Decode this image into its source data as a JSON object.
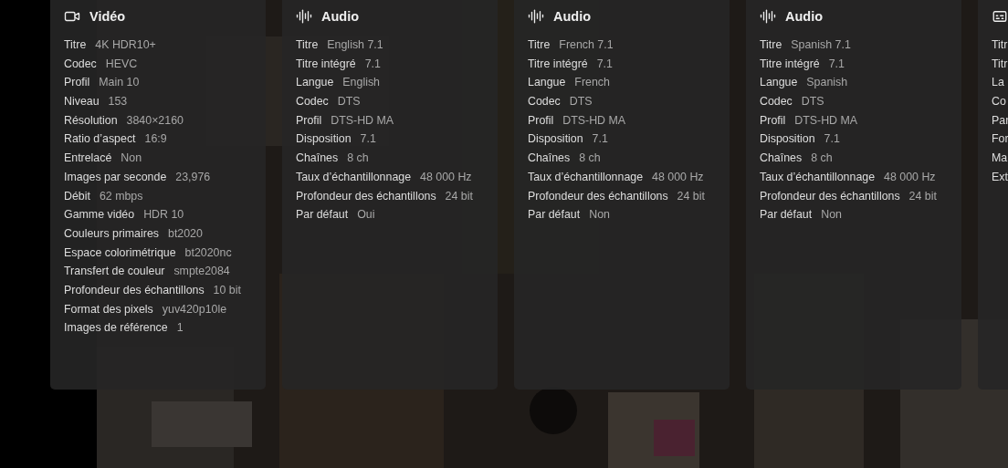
{
  "streams": [
    {
      "kind": "video",
      "title": "Vidéo",
      "rows": [
        {
          "label": "Titre",
          "value": "4K HDR10+"
        },
        {
          "label": "Codec",
          "value": "HEVC"
        },
        {
          "label": "Profil",
          "value": "Main 10"
        },
        {
          "label": "Niveau",
          "value": "153"
        },
        {
          "label": "Résolution",
          "value": "3840×2160"
        },
        {
          "label": "Ratio d’aspect",
          "value": "16:9"
        },
        {
          "label": "Entrelacé",
          "value": "Non"
        },
        {
          "label": "Images par seconde",
          "value": "23,976"
        },
        {
          "label": "Débit",
          "value": "62 mbps"
        },
        {
          "label": "Gamme vidéo",
          "value": "HDR 10"
        },
        {
          "label": "Couleurs primaires",
          "value": "bt2020"
        },
        {
          "label": "Espace colorimétrique",
          "value": "bt2020nc"
        },
        {
          "label": "Transfert de couleur",
          "value": "smpte2084"
        },
        {
          "label": "Profondeur des échantillons",
          "value": "10 bit"
        },
        {
          "label": "Format des pixels",
          "value": "yuv420p10le"
        },
        {
          "label": "Images de référence",
          "value": "1"
        }
      ]
    },
    {
      "kind": "audio",
      "title": "Audio",
      "rows": [
        {
          "label": "Titre",
          "value": "English 7.1"
        },
        {
          "label": "Titre intégré",
          "value": "7.1"
        },
        {
          "label": "Langue",
          "value": "English"
        },
        {
          "label": "Codec",
          "value": "DTS"
        },
        {
          "label": "Profil",
          "value": "DTS-HD MA"
        },
        {
          "label": "Disposition",
          "value": "7.1"
        },
        {
          "label": "Chaînes",
          "value": "8 ch"
        },
        {
          "label": "Taux d’échantillonnage",
          "value": "48 000 Hz"
        },
        {
          "label": "Profondeur des échantillons",
          "value": "24 bit"
        },
        {
          "label": "Par défaut",
          "value": "Oui"
        }
      ]
    },
    {
      "kind": "audio",
      "title": "Audio",
      "rows": [
        {
          "label": "Titre",
          "value": "French 7.1"
        },
        {
          "label": "Titre intégré",
          "value": "7.1"
        },
        {
          "label": "Langue",
          "value": "French"
        },
        {
          "label": "Codec",
          "value": "DTS"
        },
        {
          "label": "Profil",
          "value": "DTS-HD MA"
        },
        {
          "label": "Disposition",
          "value": "7.1"
        },
        {
          "label": "Chaînes",
          "value": "8 ch"
        },
        {
          "label": "Taux d’échantillonnage",
          "value": "48 000 Hz"
        },
        {
          "label": "Profondeur des échantillons",
          "value": "24 bit"
        },
        {
          "label": "Par défaut",
          "value": "Non"
        }
      ]
    },
    {
      "kind": "audio",
      "title": "Audio",
      "rows": [
        {
          "label": "Titre",
          "value": "Spanish 7.1"
        },
        {
          "label": "Titre intégré",
          "value": "7.1"
        },
        {
          "label": "Langue",
          "value": "Spanish"
        },
        {
          "label": "Codec",
          "value": "DTS"
        },
        {
          "label": "Profil",
          "value": "DTS-HD MA"
        },
        {
          "label": "Disposition",
          "value": "7.1"
        },
        {
          "label": "Chaînes",
          "value": "8 ch"
        },
        {
          "label": "Taux d’échantillonnage",
          "value": "48 000 Hz"
        },
        {
          "label": "Profondeur des échantillons",
          "value": "24 bit"
        },
        {
          "label": "Par défaut",
          "value": "Non"
        }
      ]
    },
    {
      "kind": "subtitle",
      "rows": [
        {
          "label": "Titr"
        },
        {
          "label": "Titr"
        },
        {
          "label": "La"
        },
        {
          "label": "Co"
        },
        {
          "label": "Par"
        },
        {
          "label": "For"
        },
        {
          "label": "Ma"
        },
        {
          "label": "Ext"
        }
      ]
    }
  ]
}
